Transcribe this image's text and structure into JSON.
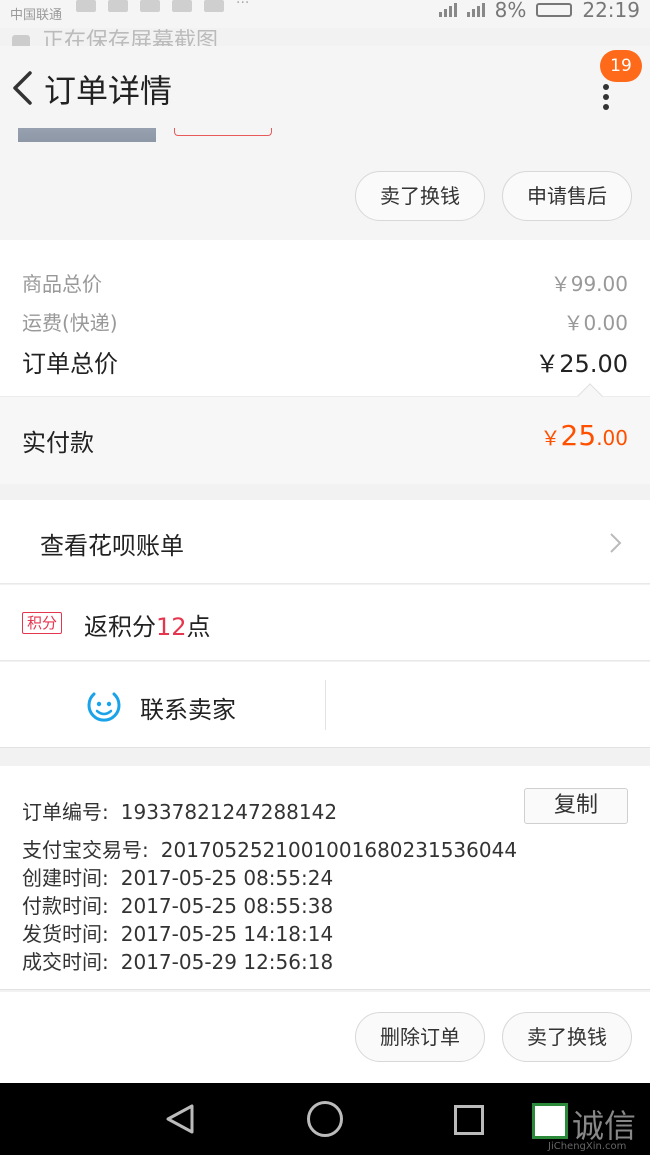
{
  "status_bar": {
    "carrier": "中国联通",
    "battery": "8%",
    "time": "22:19"
  },
  "notice": {
    "text": "正在保存屏幕截图"
  },
  "header": {
    "title": "订单详情",
    "badge_count": "19"
  },
  "item_actions": {
    "sell": "卖了换钱",
    "after_sale": "申请售后"
  },
  "price": {
    "goods_label": "商品总价",
    "goods_value": "￥99.00",
    "shipping_label": "运费(快递)",
    "shipping_value": "￥0.00",
    "total_label": "订单总价",
    "total_value": "￥25.00",
    "paid_label": "实付款",
    "paid_currency": "￥",
    "paid_int": "25",
    "paid_dec": ".00"
  },
  "huabei": {
    "label": "查看花呗账单"
  },
  "points": {
    "badge": "积分",
    "prefix": "返积分",
    "number": "12",
    "suffix": "点"
  },
  "contact": {
    "label": "联系卖家"
  },
  "order_info": {
    "copy_label": "复制",
    "lines": [
      {
        "label": "订单编号:",
        "value": "19337821247288142"
      },
      {
        "label": "支付宝交易号:",
        "value": "2017052521001001680231536044"
      },
      {
        "label": "创建时间:",
        "value": "2017-05-25 08:55:24"
      },
      {
        "label": "付款时间:",
        "value": "2017-05-25 08:55:38"
      },
      {
        "label": "发货时间:",
        "value": "2017-05-25 14:18:14"
      },
      {
        "label": "成交时间:",
        "value": "2017-05-29 12:56:18"
      }
    ]
  },
  "bottom_actions": {
    "delete": "删除订单",
    "sell": "卖了换钱"
  },
  "watermark": {
    "brand": "诚信",
    "sub": "JiChengXin.com"
  },
  "colors": {
    "accent_orange": "#ff5000",
    "badge_orange": "#ff6a1a",
    "points_red": "#e4364f",
    "contact_blue": "#1aa3e8"
  },
  "icons": [
    "back-arrow-icon",
    "more-dots-icon",
    "chevron-right-icon",
    "smile-chat-icon",
    "nav-back-icon",
    "nav-home-icon",
    "nav-recent-icon"
  ]
}
